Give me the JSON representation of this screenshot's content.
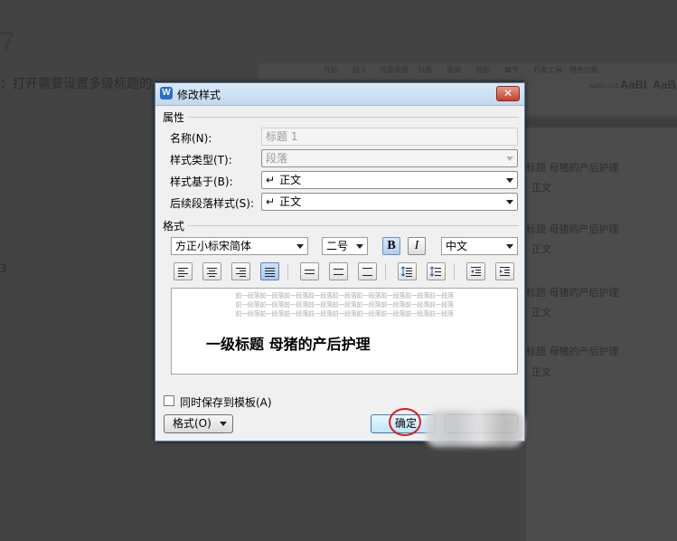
{
  "background": {
    "step_number": "7",
    "instruction": "：打开需要设置多级标题的",
    "ribbon_tabs": [
      "开始",
      "插入",
      "页面布局",
      "引用",
      "审阅",
      "视图",
      "章节",
      "开发工具",
      "特色功能"
    ],
    "style_preview_small": "AaBbCcDd",
    "style_preview_1": "AaBl",
    "style_preview_2": "AaBb",
    "doc_lines": [
      "标题  母猪的产后护理",
      "正文",
      "标题  母猪的产后护理",
      "正文",
      "标题  母猪的产后护理",
      "正文",
      "标题  母猪的产后护理",
      "正文"
    ],
    "left_mark": "3"
  },
  "dialog": {
    "title": "修改样式",
    "close_glyph": "✕",
    "properties_section": "属性",
    "name_label": "名称(N):",
    "name_value": "标题 1",
    "style_type_label": "样式类型(T):",
    "style_type_value": "段落",
    "based_on_label": "样式基于(B):",
    "based_on_value": "正文",
    "following_label": "后续段落样式(S):",
    "following_value": "正文",
    "return_glyph": "↵",
    "format_section": "格式",
    "font_value": "方正小标宋简体",
    "size_value": "二号",
    "bold_label": "B",
    "italic_label": "I",
    "language_value": "中文",
    "preview_text_line": "前一段落前一段落前一段落前一段落前一段落前一段落前一段落前一段落前一段落",
    "preview_text_line2": "前一段落前一段落前一段落前一段落前一段落前一段落前一段落前一段落前一段落",
    "preview_text_line3": "前一段落前一段落前一段落前一段落前一段落前一段落前一段落前一段落前一段落",
    "preview_heading": "一级标题  母猪的产后护理",
    "save_to_template_label": "同时保存到模板(A)",
    "format_button_label": "格式(O)",
    "ok_button_label": "确定",
    "toolbar_icons": [
      "align-left-icon",
      "align-center-icon",
      "align-right-icon",
      "align-justify-icon",
      "line-spacing-single-icon",
      "line-spacing-1-5-icon",
      "line-spacing-double-icon",
      "space-before-icon",
      "space-after-icon",
      "decrease-indent-icon",
      "increase-indent-icon"
    ]
  },
  "colors": {
    "highlight_circle": "#d81f1f",
    "titlebar": "#c3d8ef",
    "primary_button": "#bee6fd"
  }
}
